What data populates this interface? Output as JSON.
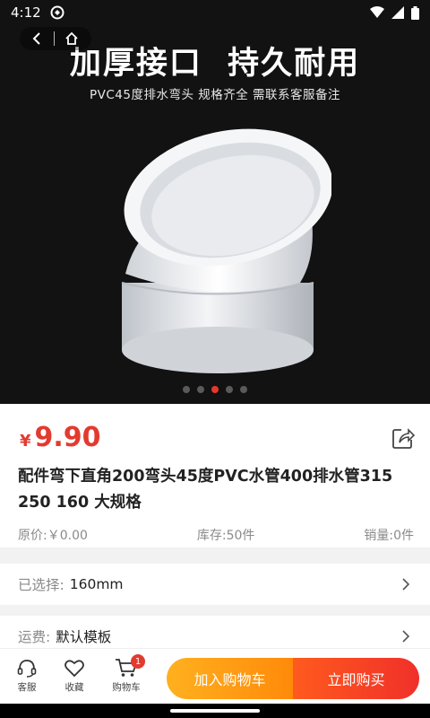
{
  "status_bar": {
    "time": "4:12"
  },
  "hero": {
    "headline": "加厚接口  持久耐用",
    "subtitle": "PVC45度排水弯头  规格齐全  需联系客服备注",
    "slide_count": 5,
    "active_slide": 2
  },
  "product": {
    "currency": "¥",
    "price": "9.90",
    "title": "配件弯下直角200弯头45度PVC水管400排水管315 250 160 大规格",
    "original_price": "原价:￥0.00",
    "stock": "库存:50件",
    "sales": "销量:0件"
  },
  "selection": {
    "label": "已选择:",
    "value": "160mm"
  },
  "shipping": {
    "label": "运费:",
    "value": "默认模板"
  },
  "bottom_bar": {
    "service_label": "客服",
    "favorite_label": "收藏",
    "cart_label": "购物车",
    "cart_count": "1",
    "add_to_cart_label": "加入购物车",
    "buy_now_label": "立即购买"
  },
  "colors": {
    "accent": "#e33a2f",
    "cart_btn": "#ff9a12",
    "buy_btn": "#f0302a"
  }
}
